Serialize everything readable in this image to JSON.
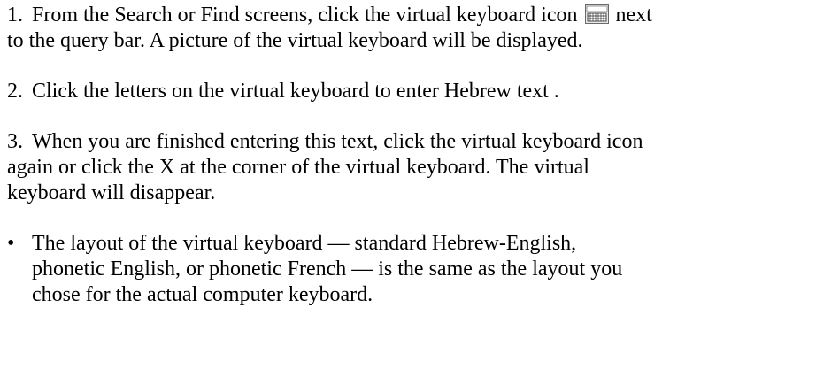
{
  "steps": [
    {
      "number": "1.",
      "text_before_icon": "From the Search or Find screens, click the virtual keyboard icon",
      "icon": "virtual-keyboard-icon",
      "text_after_icon": "next",
      "line2": "to the query bar. A picture of the virtual keyboard will be displayed."
    },
    {
      "number": "2.",
      "text": "Click the letters on the virtual keyboard to enter Hebrew text ."
    },
    {
      "number": "3.",
      "line1": "When you are finished entering this text, click the virtual keyboard icon",
      "line2": "again or click the X at the corner of the virtual keyboard. The virtual",
      "line3": "keyboard will disappear."
    }
  ],
  "note": {
    "bullet": "•",
    "line1": "The layout of the virtual keyboard — standard Hebrew-English,",
    "line2": "phonetic English, or phonetic French — is the same as the layout you",
    "line3": "chose for the actual computer keyboard."
  }
}
